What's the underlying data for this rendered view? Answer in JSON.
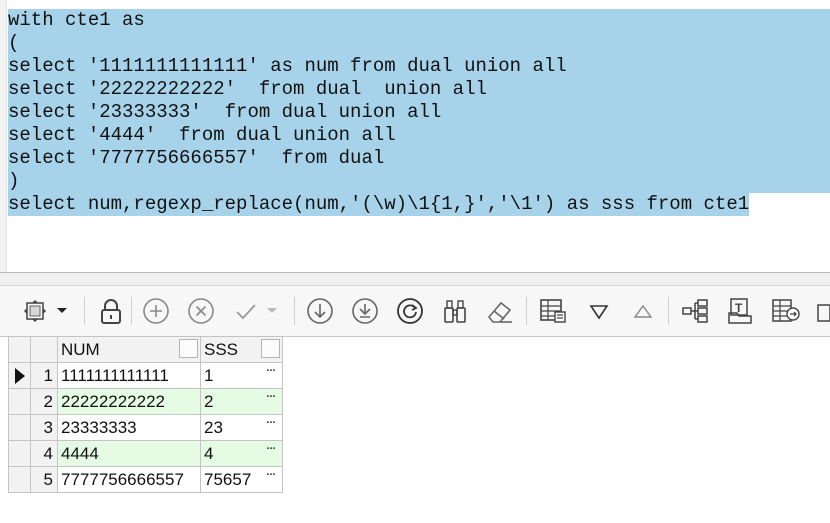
{
  "editor": {
    "lines": [
      "with cte1 as",
      "(",
      "select '1111111111111' as num from dual union all",
      "select '22222222222'  from dual  union all",
      "select '23333333'  from dual union all",
      "select '4444'  from dual union all",
      "select '7777756666557'  from dual",
      ")",
      "select num,regexp_replace(num,'(\\w)\\1{1,}','\\1') as sss from cte1"
    ],
    "selection_color": "#a6d3ea"
  },
  "toolbar": {
    "buttons": [
      "grid-view-icon",
      "dropdown-arrow-icon",
      "lock-icon",
      "add-record-icon",
      "delete-record-icon",
      "post-changes-icon",
      "post-dropdown-icon",
      "fetch-next-icon",
      "fetch-all-icon",
      "refresh-icon",
      "query-by-example-icon",
      "clear-icon",
      "single-record-view-icon",
      "filter-down-icon",
      "filter-up-icon",
      "explain-plan-icon",
      "export-text-icon",
      "export-grid-icon",
      "more-icon"
    ]
  },
  "grid": {
    "columns": [
      "NUM",
      "SSS"
    ],
    "rows": [
      {
        "no": "1",
        "num": "1111111111111",
        "sss": "1",
        "ellipsis": "..."
      },
      {
        "no": "2",
        "num": "22222222222",
        "sss": "2",
        "ellipsis": "..."
      },
      {
        "no": "3",
        "num": "23333333",
        "sss": "23",
        "ellipsis": "..."
      },
      {
        "no": "4",
        "num": "4444",
        "sss": "4",
        "ellipsis": "..."
      },
      {
        "no": "5",
        "num": "7777756666557",
        "sss": "75657",
        "ellipsis": "..."
      }
    ],
    "alt_row_color": "#e6fbe3"
  }
}
